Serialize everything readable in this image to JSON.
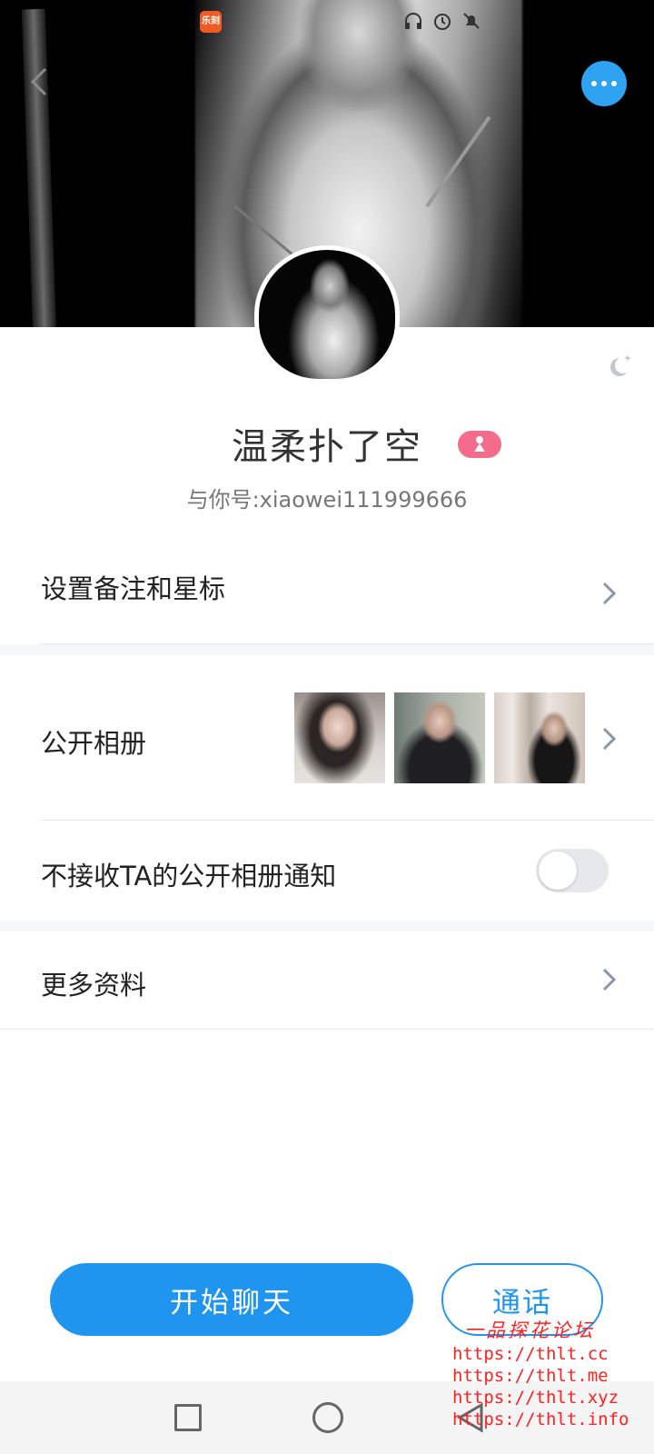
{
  "status_bar": {
    "app_icon_text": "乐刻"
  },
  "profile": {
    "name": "温柔扑了空",
    "account_id": "与你号:xiaowei111999666"
  },
  "rows": {
    "remark": "设置备注和星标",
    "album": "公开相册",
    "album_notify": "不接收TA的公开相册通知",
    "more_info": "更多资料"
  },
  "album_notify_enabled": false,
  "buttons": {
    "chat": "开始聊天",
    "call": "通话"
  },
  "watermark": {
    "title": "一品探花论坛",
    "lines": [
      "https://thlt.cc",
      "https://thlt.me",
      "https://thlt.xyz",
      "https://thlt.info"
    ]
  },
  "colors": {
    "accent": "#1f95f0",
    "gender_badge": "#f46b8c",
    "watermark": "#ff2020"
  }
}
